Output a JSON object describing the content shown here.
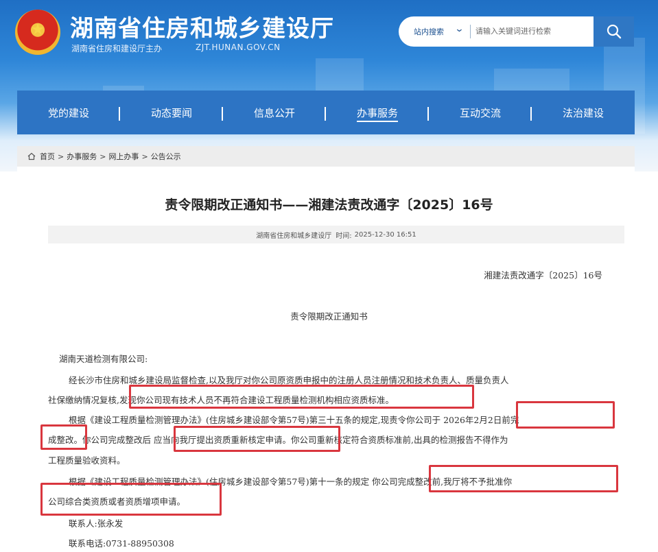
{
  "header": {
    "site_title": "湖南省住房和城乡建设厅",
    "site_subtitle": "湖南省住房和建设厅主办",
    "site_domain": "ZJT.HUNAN.GOV.CN"
  },
  "search": {
    "scope": "站内搜索",
    "placeholder": "请输入关键词进行检索"
  },
  "nav": {
    "items": [
      "党的建设",
      "动态要闻",
      "信息公开",
      "办事服务",
      "互动交流",
      "法治建设"
    ],
    "active": "办事服务"
  },
  "breadcrumb": [
    "首页",
    "办事服务",
    "网上办事",
    "公告公示"
  ],
  "article": {
    "title": "责令限期改正通知书——湘建法责改通字〔2025〕16号",
    "meta_source": "湖南省住房和城乡建设厅",
    "meta_time_label": "时间:",
    "meta_time": "2025-12-30 16:51",
    "doc_number": "湘建法责改通字〔2025〕16号",
    "subtitle": "责令限期改正通知书",
    "lines": [
      "湖南天道检测有限公司:",
      "经长沙市住房和城乡建设局监督检查,以及我厅对你公司原资质申报中的注册人员注册情况和技术负责人、质量负责人",
      "社保缴纳情况复核,发现你公司现有技术人员不再符合建设工程质量检测机构相应资质标准。",
      "根据《建设工程质量检测管理办法》(住房城乡建设部令第57号)第三十五条的规定,现责令你公司于 2026年2月2日前完",
      "成整改。你公司完成整改后 应当向我厅提出资质重新核定申请。你公司重新核定符合资质标准前,出具的检测报告不得作为",
      "工程质量验收资料。",
      "根据《建设工程质量检测管理办法》(住房城乡建设部令第57号)第十一条的规定 你公司完成整改前,我厅将不予批准你",
      "公司综合类资质或者资质增项申请。",
      "联系人:张永发",
      "联系电话:0731-88950308"
    ]
  },
  "colors": {
    "nav_bg": "#2d74c4",
    "highlight_box": "#d9363e"
  }
}
